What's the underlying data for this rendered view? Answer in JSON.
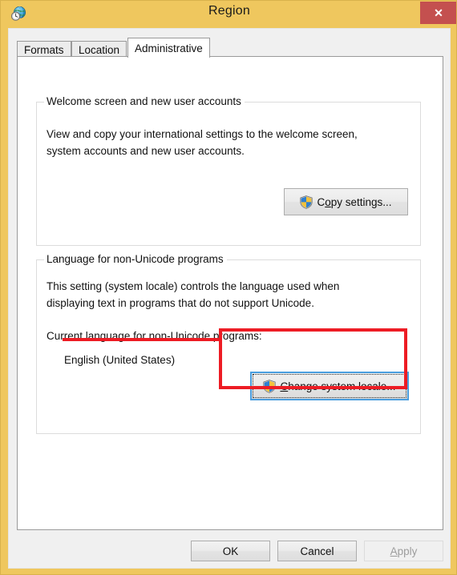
{
  "window": {
    "title": "Region",
    "icon": "region-globe-clock-icon",
    "close_label": "✕",
    "titlebar_color": "#efc75e",
    "close_button_color": "#c4504f"
  },
  "tabs": [
    {
      "label": "Formats",
      "active": false
    },
    {
      "label": "Location",
      "active": false
    },
    {
      "label": "Administrative",
      "active": true
    }
  ],
  "groups": {
    "welcome": {
      "title": "Welcome screen and new user accounts",
      "description_line1": "View and copy your international settings to the welcome screen,",
      "description_line2": "system accounts and new user accounts.",
      "button": {
        "label_prefix": "C",
        "label_accel": "o",
        "label_suffix": "py settings...",
        "full_label": "Copy settings...",
        "icon": "uac-shield-icon"
      }
    },
    "language": {
      "title": "Language for non-Unicode programs",
      "description_line1": "This setting (system locale) controls the language used when",
      "description_line2": "displaying text in programs that do not support Unicode.",
      "current_label": "Current language for non-Unicode programs:",
      "current_value": "English (United States)",
      "button": {
        "label_accel": "C",
        "label_suffix": "hange system locale...",
        "full_label": "Change system locale...",
        "icon": "uac-shield-icon",
        "focused": true
      }
    }
  },
  "footer": {
    "ok_label": "OK",
    "cancel_label": "Cancel",
    "apply_accel": "A",
    "apply_suffix": "pply",
    "apply_full_label": "Apply",
    "apply_disabled": true
  },
  "annotations": {
    "color": "#ed1c24",
    "highlight_box_target": "change-system-locale-button",
    "underline_target": "current-language-value"
  }
}
